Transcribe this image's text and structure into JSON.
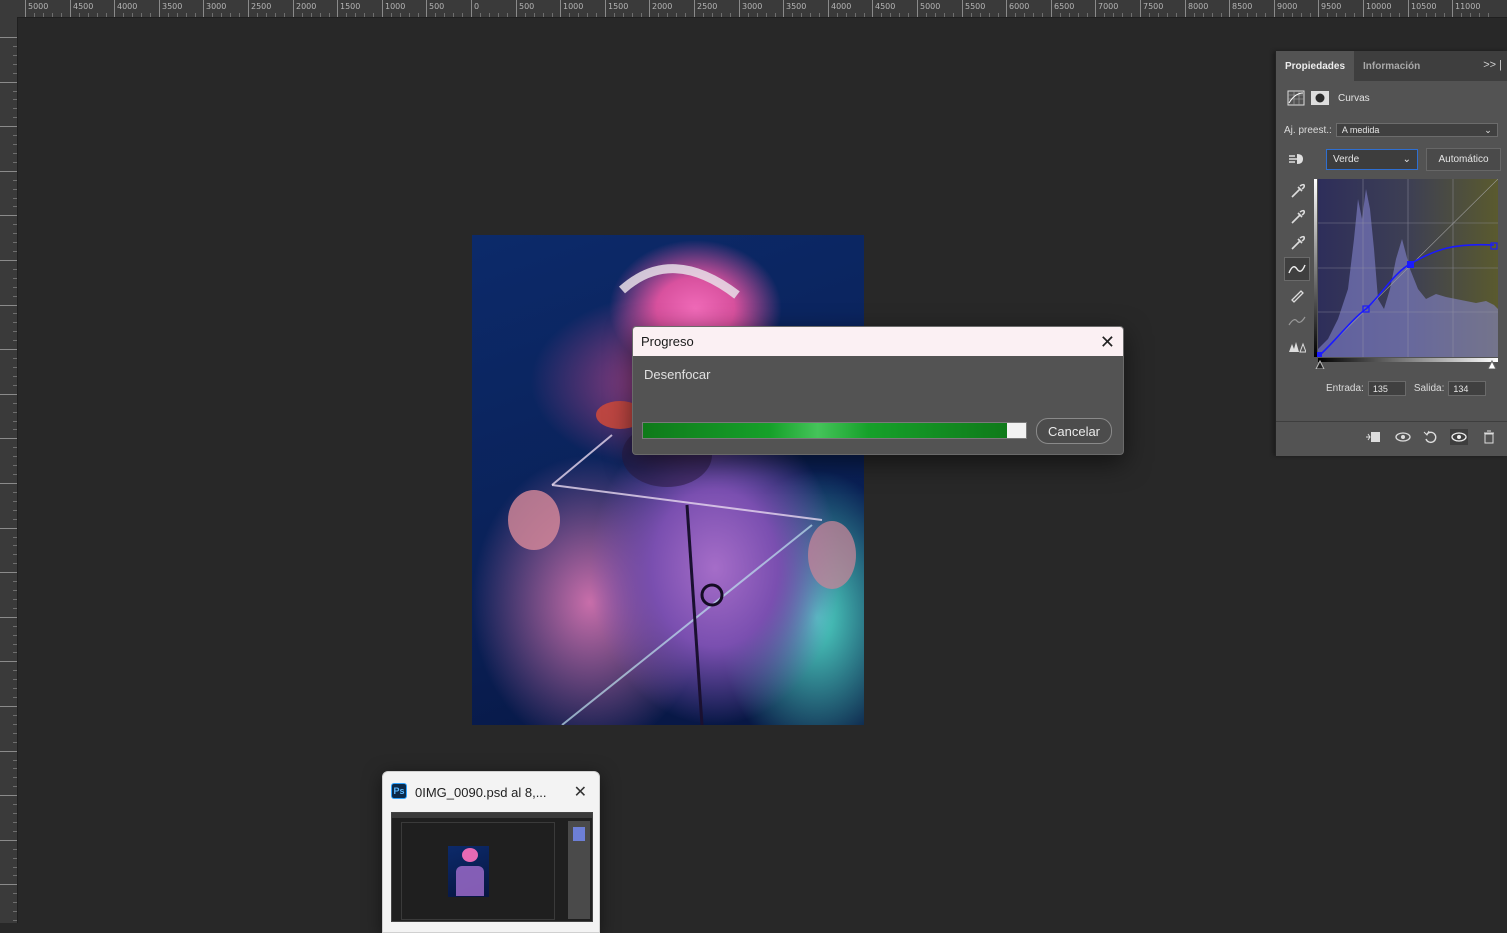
{
  "ruler": {
    "labels": [
      "5000",
      "4500",
      "4000",
      "3500",
      "3000",
      "2500",
      "2000",
      "1500",
      "1000",
      "500",
      "0",
      "500",
      "1000",
      "1500",
      "2000",
      "2500",
      "3000",
      "3500",
      "4000",
      "4500",
      "5000",
      "5500",
      "6000",
      "6500",
      "7000",
      "7500",
      "8000",
      "8500",
      "9000",
      "9500",
      "10000",
      "10500",
      "11000"
    ]
  },
  "progress_dialog": {
    "title": "Progreso",
    "message": "Desenfocar",
    "progress_percent": 95,
    "cancel_label": "Cancelar",
    "close_icon": "close-icon"
  },
  "properties_panel": {
    "tabs": [
      "Propiedades",
      "Información"
    ],
    "active_tab": "Propiedades",
    "adjustment_label": "Curvas",
    "preset_label": "Aj. preest.:",
    "preset_value": "A medida",
    "channel_value": "Verde",
    "auto_label": "Automático",
    "input_label": "Entrada:",
    "input_value": "135",
    "output_label": "Salida:",
    "output_value": "134",
    "curve_color": "#1a1aff"
  },
  "taskbar_preview": {
    "app_icon_text": "Ps",
    "title": "0IMG_0090.psd al 8,..."
  }
}
